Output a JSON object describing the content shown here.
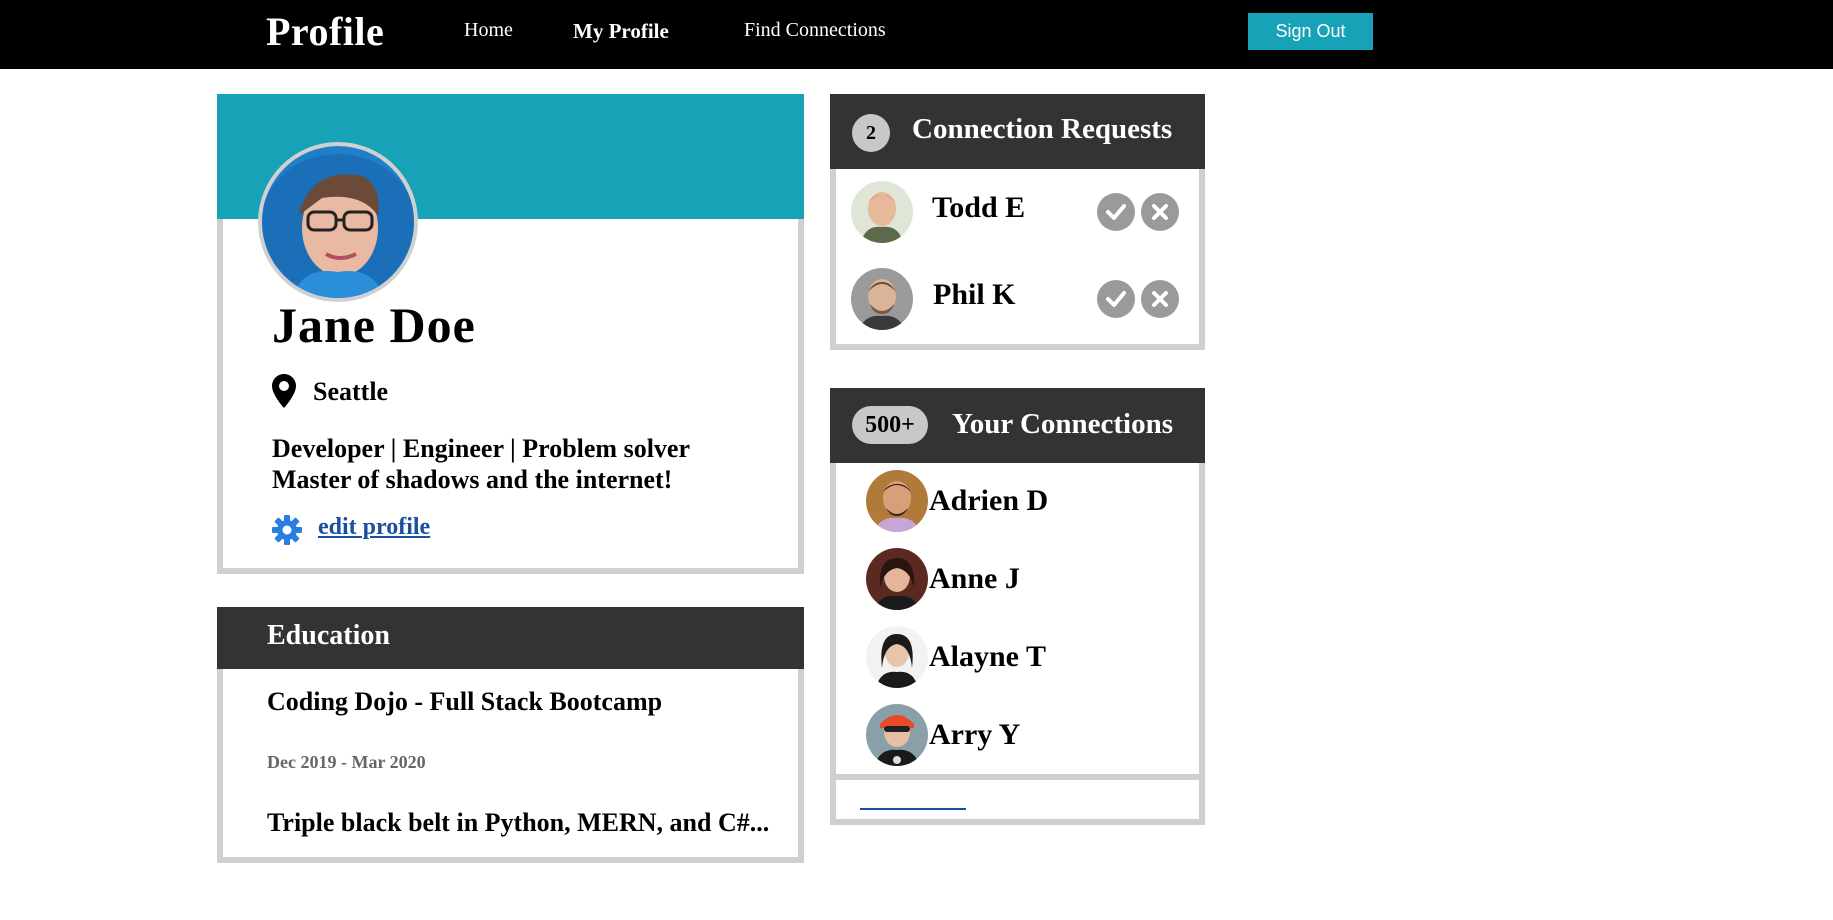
{
  "nav": {
    "brand": "Profile",
    "links": [
      "Home",
      "My Profile",
      "Find Connections"
    ],
    "sign_out": "Sign Out"
  },
  "profile": {
    "name": "Jane Doe",
    "location": "Seattle",
    "bio_line1": "Developer | Engineer | Problem solver",
    "bio_line2": "Master of shadows and the internet!",
    "edit_label": "edit profile",
    "banner_color": "#17a2b8"
  },
  "education": {
    "title": "Education",
    "school": "Coding Dojo - Full Stack Bootcamp",
    "dates": "Dec 2019 - Mar 2020",
    "description": "Triple black belt in Python, MERN, and C#..."
  },
  "requests": {
    "count": "2",
    "title": "Connection Requests",
    "people": [
      {
        "name": "Todd E"
      },
      {
        "name": "Phil K"
      }
    ]
  },
  "connections": {
    "count": "500+",
    "title": "Your Connections",
    "people": [
      {
        "name": "Adrien D"
      },
      {
        "name": "Anne J"
      },
      {
        "name": "Alayne T"
      },
      {
        "name": "Arry Y"
      }
    ]
  },
  "icons": {
    "location": "map-pin-icon",
    "settings": "gear-icon",
    "accept": "check-circle-icon",
    "decline": "x-circle-icon"
  },
  "colors": {
    "accent": "#17a2b8",
    "header_dark": "#333333",
    "link": "#1a4f9e"
  }
}
